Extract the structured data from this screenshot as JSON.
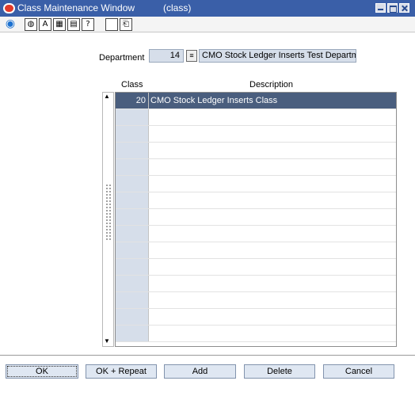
{
  "window": {
    "title": "Class Maintenance Window",
    "context": "(class)"
  },
  "toolbar": {
    "icons": [
      "globe-icon",
      "web-icon",
      "spell-icon",
      "calculator-icon",
      "notes-icon",
      "help-icon",
      "blank-icon",
      "document-icon"
    ],
    "glyphs": {
      "globe": "◉",
      "web": "◍",
      "spell": "A",
      "calc": "▦",
      "notes": "▤",
      "help": "?",
      "blank": "",
      "doc": "⎗"
    }
  },
  "department": {
    "label": "Department",
    "number": "14",
    "description": "CMO Stock Ledger Inserts Test Departme"
  },
  "table": {
    "headers": {
      "class": "Class",
      "description": "Description"
    },
    "rows": [
      {
        "class": "20",
        "description": "CMO Stock Ledger Inserts Class"
      },
      {
        "class": "",
        "description": ""
      },
      {
        "class": "",
        "description": ""
      },
      {
        "class": "",
        "description": ""
      },
      {
        "class": "",
        "description": ""
      },
      {
        "class": "",
        "description": ""
      },
      {
        "class": "",
        "description": ""
      },
      {
        "class": "",
        "description": ""
      },
      {
        "class": "",
        "description": ""
      },
      {
        "class": "",
        "description": ""
      },
      {
        "class": "",
        "description": ""
      },
      {
        "class": "",
        "description": ""
      },
      {
        "class": "",
        "description": ""
      },
      {
        "class": "",
        "description": ""
      },
      {
        "class": "",
        "description": ""
      }
    ]
  },
  "buttons": {
    "ok": "OK",
    "ok_repeat": "OK + Repeat",
    "add": "Add",
    "delete": "Delete",
    "cancel": "Cancel"
  },
  "colors": {
    "titlebar": "#3a5fa8",
    "selected_row": "#4a5e7e",
    "field": "#d6deea",
    "button": "#dfe7f2"
  }
}
